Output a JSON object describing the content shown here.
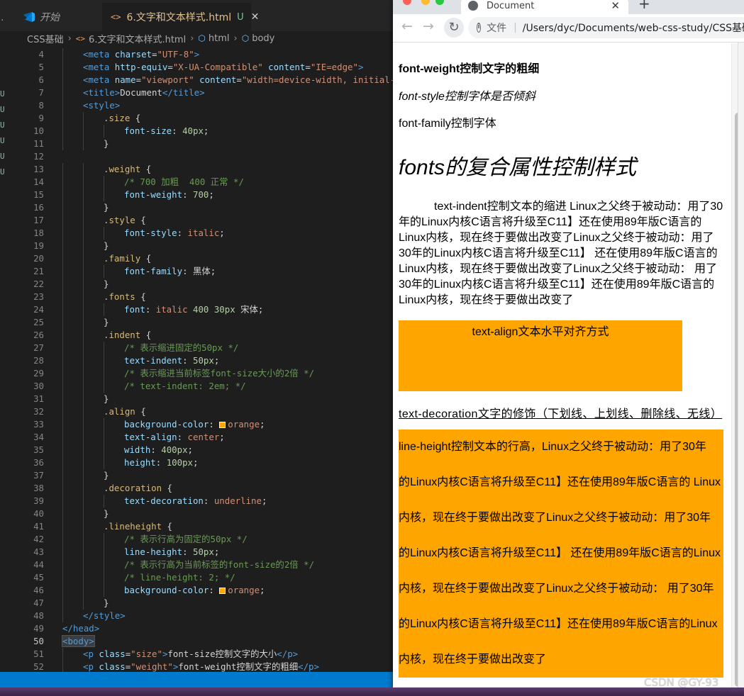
{
  "editor": {
    "tabs": [
      {
        "label": "开始"
      },
      {
        "label": "6.文字和文本样式.html",
        "badge": "U"
      }
    ],
    "breadcrumb": [
      "CSS基础",
      "6.文字和文本样式.html",
      "html",
      "body"
    ],
    "activity_marks": [
      "·",
      "U",
      "U",
      "U",
      "U",
      "U",
      "U"
    ],
    "current_line": 50
  },
  "browser": {
    "tab_title": "Document",
    "new_tab": "+",
    "url_prefix": "文件",
    "url": "/Users/dyc/Documents/web-css-study/CSS基础",
    "page": {
      "weight_text": "font-weight控制文字的粗细",
      "style_text": "font-style控制字体是否倾斜",
      "family_text": "font-family控制字体",
      "fonts_text": "fonts的复合属性控制样式",
      "indent_text": "text-indent控制文本的缩进 Linux之父终于被动动：用了30年的Linux内核C语言将升级至C11】还在使用89年版C语言的Linux内核，现在终于要做出改变了Linux之父终于被动动：用了30年的Linux内核C语言将升级至C11】 还在使用89年版C语言的Linux内核，现在终于要做出改变了Linux之父终于被动动： 用了30年的Linux内核C语言将升级至C11】还在使用89年版C语言的Linux内核，现在终于要做出改变了",
      "align_text": "text-align文本水平对齐方式",
      "decoration_text": "text-decoration文字的修饰（下划线、上划线、删除线、无线）",
      "lineheight_lines": [
        "line-height控制文本的行高，Linux之父终于被动动：用了30年",
        "的Linux内核C语言将升级至C11】还在使用89年版C语言的 Linux",
        "内核，现在终于要做出改变了Linux之父终于被动动：用了30年",
        "的Linux内核C语言将升级至C11】 还在使用89年版C语言的Linux",
        "内核，现在终于要做出改变了Linux之父终于被动动： 用了30年",
        "的Linux内核C语言将升级至C11】还在使用89年版C语言的Linux",
        "内核，现在终于要做出改变了"
      ]
    }
  },
  "watermark": "CSDN @GY-93",
  "colors": {
    "orange": "#ffa500",
    "editor_bg": "#1e1e1e",
    "status_bar": "#007acc"
  },
  "code_lines": [
    {
      "n": 4,
      "i": 1,
      "t": [
        [
          "tag",
          "<meta "
        ],
        [
          "attr",
          "charset"
        ],
        [
          "txt",
          "="
        ],
        [
          "str",
          "\"UTF-8\""
        ],
        [
          "tag",
          ">"
        ]
      ]
    },
    {
      "n": 5,
      "i": 1,
      "t": [
        [
          "tag",
          "<meta "
        ],
        [
          "attr",
          "http-equiv"
        ],
        [
          "txt",
          "="
        ],
        [
          "str",
          "\"X-UA-Compatible\""
        ],
        [
          "txt",
          " "
        ],
        [
          "attr",
          "content"
        ],
        [
          "txt",
          "="
        ],
        [
          "str",
          "\"IE=edge\""
        ],
        [
          "tag",
          ">"
        ]
      ]
    },
    {
      "n": 6,
      "i": 1,
      "t": [
        [
          "tag",
          "<meta "
        ],
        [
          "attr",
          "name"
        ],
        [
          "txt",
          "="
        ],
        [
          "str",
          "\"viewport\""
        ],
        [
          "txt",
          " "
        ],
        [
          "attr",
          "content"
        ],
        [
          "txt",
          "="
        ],
        [
          "str",
          "\"width=device-width, initial-sc"
        ]
      ]
    },
    {
      "n": 7,
      "i": 1,
      "t": [
        [
          "tag",
          "<title>"
        ],
        [
          "txt",
          "Document"
        ],
        [
          "tag",
          "</title>"
        ]
      ]
    },
    {
      "n": 8,
      "i": 1,
      "t": [
        [
          "tag",
          "<style>"
        ]
      ]
    },
    {
      "n": 9,
      "i": 2,
      "t": [
        [
          "sel",
          ".size "
        ],
        [
          "txt",
          "{"
        ]
      ]
    },
    {
      "n": 10,
      "i": 3,
      "t": [
        [
          "prop",
          "font-size"
        ],
        [
          "txt",
          ": "
        ],
        [
          "num",
          "40px"
        ],
        [
          "txt",
          ";"
        ]
      ]
    },
    {
      "n": 11,
      "i": 2,
      "t": [
        [
          "txt",
          "}"
        ]
      ]
    },
    {
      "n": 12,
      "i": 0,
      "t": []
    },
    {
      "n": 13,
      "i": 2,
      "t": [
        [
          "sel",
          ".weight "
        ],
        [
          "txt",
          "{"
        ]
      ]
    },
    {
      "n": 14,
      "i": 3,
      "t": [
        [
          "com",
          "/* 700 加粗  400 正常 */"
        ]
      ]
    },
    {
      "n": 15,
      "i": 3,
      "t": [
        [
          "prop",
          "font-weight"
        ],
        [
          "txt",
          ": "
        ],
        [
          "num",
          "700"
        ],
        [
          "txt",
          ";"
        ]
      ]
    },
    {
      "n": 16,
      "i": 2,
      "t": [
        [
          "txt",
          "}"
        ]
      ]
    },
    {
      "n": 17,
      "i": 2,
      "t": [
        [
          "sel",
          ".style "
        ],
        [
          "txt",
          "{"
        ]
      ]
    },
    {
      "n": 18,
      "i": 3,
      "t": [
        [
          "prop",
          "font-style"
        ],
        [
          "txt",
          ": "
        ],
        [
          "val",
          "italic"
        ],
        [
          "txt",
          ";"
        ]
      ]
    },
    {
      "n": 19,
      "i": 2,
      "t": [
        [
          "txt",
          "}"
        ]
      ]
    },
    {
      "n": 20,
      "i": 2,
      "t": [
        [
          "sel",
          ".family "
        ],
        [
          "txt",
          "{"
        ]
      ]
    },
    {
      "n": 21,
      "i": 3,
      "t": [
        [
          "prop",
          "font-family"
        ],
        [
          "txt",
          ": 黑体;"
        ]
      ]
    },
    {
      "n": 22,
      "i": 2,
      "t": [
        [
          "txt",
          "}"
        ]
      ]
    },
    {
      "n": 23,
      "i": 2,
      "t": [
        [
          "sel",
          ".fonts "
        ],
        [
          "txt",
          "{"
        ]
      ]
    },
    {
      "n": 24,
      "i": 3,
      "t": [
        [
          "prop",
          "font"
        ],
        [
          "txt",
          ": "
        ],
        [
          "val",
          "italic "
        ],
        [
          "num",
          "400 30px"
        ],
        [
          "txt",
          " 宋体;"
        ]
      ]
    },
    {
      "n": 25,
      "i": 2,
      "t": [
        [
          "txt",
          "}"
        ]
      ]
    },
    {
      "n": 26,
      "i": 2,
      "t": [
        [
          "sel",
          ".indent "
        ],
        [
          "txt",
          "{"
        ]
      ]
    },
    {
      "n": 27,
      "i": 3,
      "t": [
        [
          "com",
          "/* 表示缩进固定的50px */"
        ]
      ]
    },
    {
      "n": 28,
      "i": 3,
      "t": [
        [
          "prop",
          "text-indent"
        ],
        [
          "txt",
          ": "
        ],
        [
          "num",
          "50px"
        ],
        [
          "txt",
          ";"
        ]
      ]
    },
    {
      "n": 29,
      "i": 3,
      "t": [
        [
          "com",
          "/* 表示缩进当前标签font-size大小的2倍 */"
        ]
      ]
    },
    {
      "n": 30,
      "i": 3,
      "t": [
        [
          "com",
          "/* text-indent: 2em; */"
        ]
      ]
    },
    {
      "n": 31,
      "i": 2,
      "t": [
        [
          "txt",
          "}"
        ]
      ]
    },
    {
      "n": 32,
      "i": 2,
      "t": [
        [
          "sel",
          ".align "
        ],
        [
          "txt",
          "{"
        ]
      ]
    },
    {
      "n": 33,
      "i": 3,
      "t": [
        [
          "prop",
          "background-color"
        ],
        [
          "txt",
          ": "
        ],
        [
          "sw",
          ""
        ],
        [
          "val",
          "orange"
        ],
        [
          "txt",
          ";"
        ]
      ]
    },
    {
      "n": 34,
      "i": 3,
      "t": [
        [
          "prop",
          "text-align"
        ],
        [
          "txt",
          ": "
        ],
        [
          "val",
          "center"
        ],
        [
          "txt",
          ";"
        ]
      ]
    },
    {
      "n": 35,
      "i": 3,
      "t": [
        [
          "prop",
          "width"
        ],
        [
          "txt",
          ": "
        ],
        [
          "num",
          "400px"
        ],
        [
          "txt",
          ";"
        ]
      ]
    },
    {
      "n": 36,
      "i": 3,
      "t": [
        [
          "prop",
          "height"
        ],
        [
          "txt",
          ": "
        ],
        [
          "num",
          "100px"
        ],
        [
          "txt",
          ";"
        ]
      ]
    },
    {
      "n": 37,
      "i": 2,
      "t": [
        [
          "txt",
          "}"
        ]
      ]
    },
    {
      "n": 38,
      "i": 2,
      "t": [
        [
          "sel",
          ".decoration "
        ],
        [
          "txt",
          "{"
        ]
      ]
    },
    {
      "n": 39,
      "i": 3,
      "t": [
        [
          "prop",
          "text-decoration"
        ],
        [
          "txt",
          ": "
        ],
        [
          "val",
          "underline"
        ],
        [
          "txt",
          ";"
        ]
      ]
    },
    {
      "n": 40,
      "i": 2,
      "t": [
        [
          "txt",
          "}"
        ]
      ]
    },
    {
      "n": 41,
      "i": 2,
      "t": [
        [
          "sel",
          ".lineheight "
        ],
        [
          "txt",
          "{"
        ]
      ]
    },
    {
      "n": 42,
      "i": 3,
      "t": [
        [
          "com",
          "/* 表示行高为固定的50px */"
        ]
      ]
    },
    {
      "n": 43,
      "i": 3,
      "t": [
        [
          "prop",
          "line-height"
        ],
        [
          "txt",
          ": "
        ],
        [
          "num",
          "50px"
        ],
        [
          "txt",
          ";"
        ]
      ]
    },
    {
      "n": 44,
      "i": 3,
      "t": [
        [
          "com",
          "/* 表示行高为当前标签的font-size的2倍 */"
        ]
      ]
    },
    {
      "n": 45,
      "i": 3,
      "t": [
        [
          "com",
          "/* line-height: 2; */"
        ]
      ]
    },
    {
      "n": 46,
      "i": 3,
      "t": [
        [
          "prop",
          "background-color"
        ],
        [
          "txt",
          ": "
        ],
        [
          "sw",
          ""
        ],
        [
          "val",
          "orange"
        ],
        [
          "txt",
          ";"
        ]
      ]
    },
    {
      "n": 47,
      "i": 2,
      "t": [
        [
          "txt",
          "}"
        ]
      ]
    },
    {
      "n": 48,
      "i": 1,
      "t": [
        [
          "tag",
          "</style>"
        ]
      ]
    },
    {
      "n": 49,
      "i": 0,
      "t": [
        [
          "tag",
          "</head>"
        ]
      ]
    },
    {
      "n": 50,
      "i": 0,
      "t": [
        [
          "hl",
          "<body>"
        ]
      ]
    },
    {
      "n": 51,
      "i": 1,
      "t": [
        [
          "tag",
          "<p "
        ],
        [
          "attr",
          "class"
        ],
        [
          "txt",
          "="
        ],
        [
          "str",
          "\"size\""
        ],
        [
          "tag",
          ">"
        ],
        [
          "txt",
          "font-size控制文字的大小"
        ],
        [
          "tag",
          "</p>"
        ]
      ]
    },
    {
      "n": 52,
      "i": 1,
      "t": [
        [
          "tag",
          "<p "
        ],
        [
          "attr",
          "class"
        ],
        [
          "txt",
          "="
        ],
        [
          "str",
          "\"weight\""
        ],
        [
          "tag",
          ">"
        ],
        [
          "txt",
          "font-weight控制文字的粗细"
        ],
        [
          "tag",
          "</p>"
        ]
      ]
    }
  ]
}
